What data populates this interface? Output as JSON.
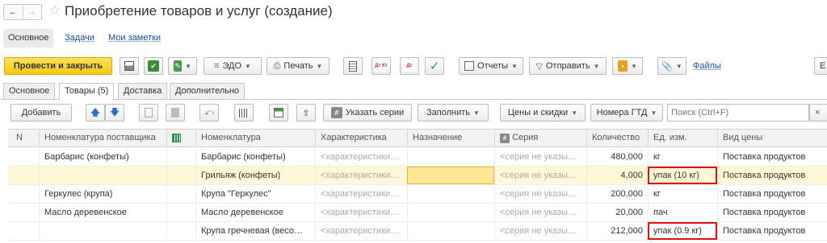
{
  "window": {
    "title": "Приобретение товаров и услуг (создание)"
  },
  "top_nav": {
    "main": "Основное",
    "tasks": "Задачи",
    "notes": "Мои заметки"
  },
  "toolbar": {
    "post_close": "Провести и закрыть",
    "edo": "ЭДО",
    "print": "Печать",
    "dt_ct": "Дт Кт",
    "reports": "Отчеты",
    "send": "Отправить",
    "files": "Файлы",
    "more": "Е"
  },
  "tabs": [
    {
      "label": "Основное"
    },
    {
      "label": "Товары (5)"
    },
    {
      "label": "Доставка"
    },
    {
      "label": "Дополнительно"
    }
  ],
  "table_toolbar": {
    "add": "Добавить",
    "specify_series": "Указать серии",
    "fill": "Заполнить",
    "prices_discounts": "Цены и скидки",
    "gtd_numbers": "Номера ГТД",
    "search_placeholder": "Поиск (Ctrl+F)",
    "clear": "×"
  },
  "columns": [
    "N",
    "Номенклатура поставщика",
    "Номенклатура",
    "Характеристика",
    "Назначение",
    "Серия",
    "Количество",
    "Ед. изм.",
    "Вид цены"
  ],
  "rows": [
    {
      "supplier_item": "Барбарис (конфеты)",
      "item": "Барбарис (конфеты)",
      "characteristic": "<характеристики…",
      "purpose": "",
      "series": "<серия не указы…",
      "qty": "480,000",
      "unit": "кг",
      "price_type": "Поставка продуктов"
    },
    {
      "supplier_item": "",
      "item": "Грильяж (конфеты)",
      "characteristic": "<характеристики…",
      "purpose": "",
      "series": "<серия не указы…",
      "qty": "4,000",
      "unit": "упак (10 кг)",
      "price_type": "Поставка продуктов"
    },
    {
      "supplier_item": "Геркулес (крупа)",
      "item": "Крупа \"Геркулес\"",
      "characteristic": "<характеристики…",
      "purpose": "",
      "series": "<серия не указы…",
      "qty": "200,000",
      "unit": "кг",
      "price_type": "Поставка продуктов"
    },
    {
      "supplier_item": "Масло деревенское",
      "item": "Масло деревенское",
      "characteristic": "<характеристики…",
      "purpose": "",
      "series": "<серия не указы…",
      "qty": "20,000",
      "unit": "пач",
      "price_type": "Поставка продуктов"
    },
    {
      "supplier_item": "",
      "item": "Крупа гречневая (весо…",
      "characteristic": "<характеристики…",
      "purpose": "",
      "series": "<серия не указы…",
      "qty": "212,000",
      "unit": "упак (0.9 кг)",
      "price_type": "Поставка продуктов"
    }
  ]
}
